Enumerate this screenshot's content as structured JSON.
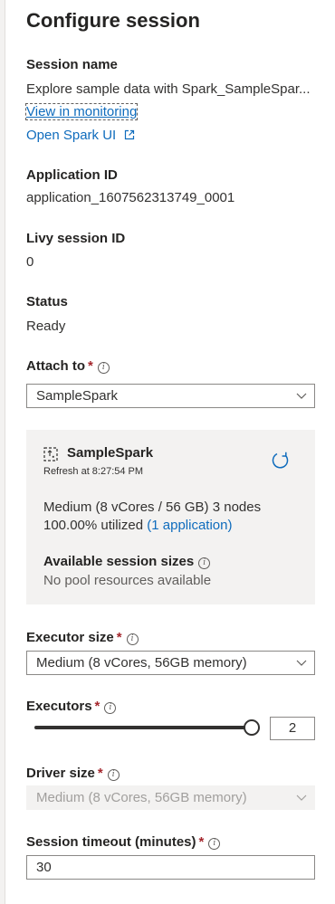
{
  "panel": {
    "title": "Configure session"
  },
  "session_name": {
    "label": "Session name",
    "value": "Explore sample data with Spark_SampleSpar...",
    "monitoring_link": "View in monitoring",
    "spark_ui_link": "Open Spark UI"
  },
  "application_id": {
    "label": "Application ID",
    "value": "application_1607562313749_0001"
  },
  "livy_session_id": {
    "label": "Livy session ID",
    "value": "0"
  },
  "status": {
    "label": "Status",
    "value": "Ready"
  },
  "attach_to": {
    "label": "Attach to",
    "required_mark": "*",
    "selected": "SampleSpark"
  },
  "pool": {
    "name": "SampleSpark",
    "refresh_text": "Refresh at 8:27:54 PM",
    "size_text": "Medium (8 vCores / 56 GB) 3 nodes",
    "utilized_text": "100.00% utilized",
    "application_link": "(1 application)",
    "available_label": "Available session sizes",
    "available_value": "No pool resources available"
  },
  "executor_size": {
    "label": "Executor size",
    "required_mark": "*",
    "selected": "Medium (8 vCores, 56GB memory)"
  },
  "executors": {
    "label": "Executors",
    "required_mark": "*",
    "value": "2",
    "slider_fraction": 1.0
  },
  "driver_size": {
    "label": "Driver size",
    "required_mark": "*",
    "selected": "Medium (8 vCores, 56GB memory)"
  },
  "session_timeout": {
    "label": "Session timeout (minutes)",
    "required_mark": "*",
    "value": "30"
  },
  "icons": {
    "info": "i",
    "external_link": "external-link-icon",
    "refresh": "refresh-icon",
    "pool": "spark-pool-icon",
    "chevron": "chevron-down-icon"
  },
  "colors": {
    "accent": "#0f6cbd",
    "required": "#a4262c",
    "pool_box_bg": "#f3f2f1"
  }
}
